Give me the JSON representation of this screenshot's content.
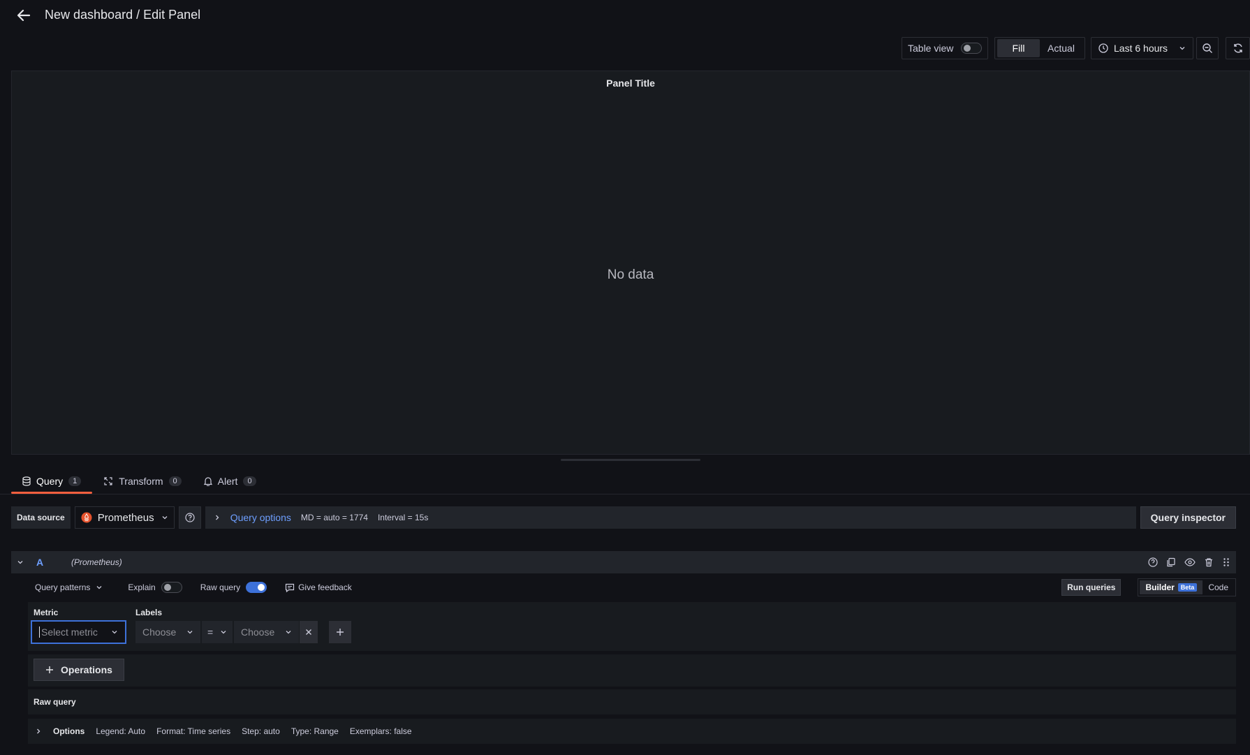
{
  "header": {
    "title": "New dashboard / Edit Panel"
  },
  "toolbar": {
    "table_view_label": "Table view",
    "fill_label": "Fill",
    "actual_label": "Actual",
    "time_range": "Last 6 hours"
  },
  "panel": {
    "title": "Panel Title",
    "empty_message": "No data"
  },
  "tabs": [
    {
      "label": "Query",
      "count": "1"
    },
    {
      "label": "Transform",
      "count": "0"
    },
    {
      "label": "Alert",
      "count": "0"
    }
  ],
  "datasource": {
    "label": "Data source",
    "name": "Prometheus",
    "query_options_label": "Query options",
    "md": "MD = auto = 1774",
    "interval": "Interval = 15s",
    "inspector_label": "Query inspector"
  },
  "query": {
    "ref_id": "A",
    "datasource": "(Prometheus)",
    "patterns_label": "Query patterns",
    "explain_label": "Explain",
    "raw_query_label": "Raw query",
    "feedback_label": "Give feedback",
    "run_label": "Run queries",
    "builder_label": "Builder",
    "beta_label": "Beta",
    "code_label": "Code",
    "metric_label": "Metric",
    "metric_placeholder": "Select metric",
    "labels_label": "Labels",
    "label_key_placeholder": "Choose",
    "label_op": "=",
    "label_value_placeholder": "Choose",
    "operations_label": "Operations",
    "raw_section_label": "Raw query",
    "options": {
      "label": "Options",
      "legend": "Legend: Auto",
      "format": "Format: Time series",
      "step": "Step: auto",
      "type": "Type: Range",
      "exemplars": "Exemplars: false"
    }
  },
  "colors": {
    "accent": "#3d71d9",
    "tab_underline": "#f55f3e",
    "link": "#6e9fff"
  }
}
